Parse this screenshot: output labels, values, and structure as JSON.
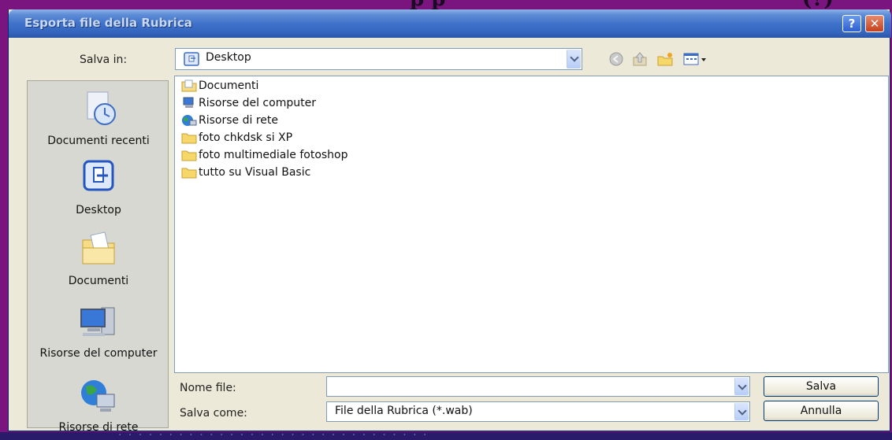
{
  "window": {
    "title": "Esporta file della Rubrica",
    "help_label": "?",
    "close_label": "✕"
  },
  "toolbar": {
    "save_in_label": "Salva in:",
    "save_in_value": "Desktop",
    "icons": [
      "back-icon",
      "up-folder-icon",
      "new-folder-icon",
      "view-menu-icon"
    ]
  },
  "places": [
    {
      "label": "Documenti recenti",
      "icon": "recent-documents-icon"
    },
    {
      "label": "Desktop",
      "icon": "desktop-icon"
    },
    {
      "label": "Documenti",
      "icon": "my-documents-icon"
    },
    {
      "label": "Risorse del computer",
      "icon": "my-computer-icon"
    },
    {
      "label": "Risorse di rete",
      "icon": "network-icon"
    }
  ],
  "files": [
    {
      "name": "Documenti",
      "icon": "my-documents-icon"
    },
    {
      "name": "Risorse del computer",
      "icon": "my-computer-icon"
    },
    {
      "name": "Risorse di rete",
      "icon": "network-icon"
    },
    {
      "name": "foto chkdsk si XP",
      "icon": "folder-icon"
    },
    {
      "name": "foto multimediale fotoshop",
      "icon": "folder-icon"
    },
    {
      "name": "tutto su Visual Basic",
      "icon": "folder-icon"
    }
  ],
  "form": {
    "filename_label": "Nome file:",
    "filename_value": "",
    "savetype_label": "Salva come:",
    "savetype_value": "File della Rubrica (*.wab)"
  },
  "buttons": {
    "save": "Salva",
    "cancel": "Annulla"
  },
  "colors": {
    "page_background": "#7a1580",
    "titlebar": "#3566bf",
    "dialog": "#ece9d8"
  }
}
